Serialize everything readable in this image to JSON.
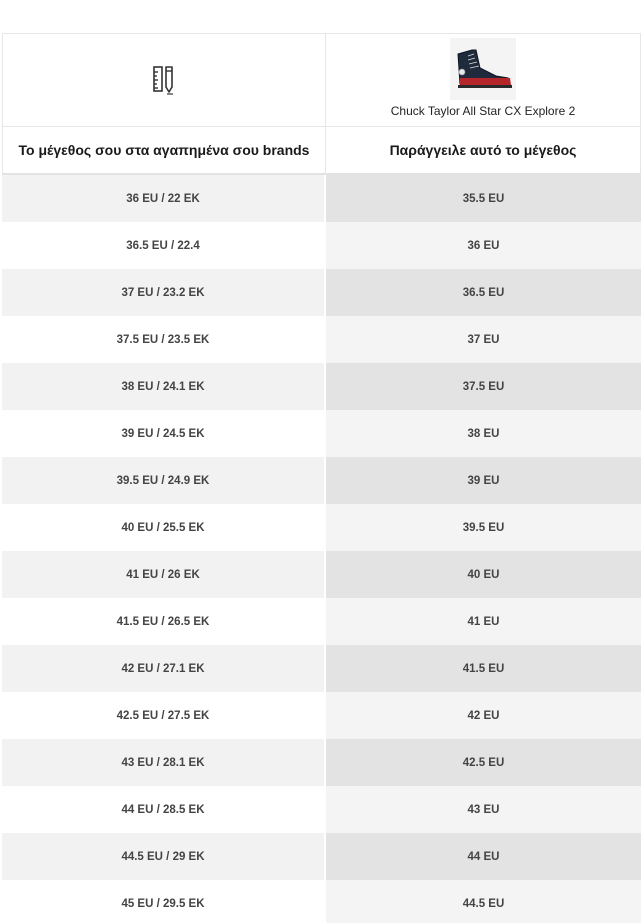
{
  "header": {
    "icon": "ruler-pencil-icon",
    "product_image": "sneaker-image",
    "product_name": "Chuck Taylor All Star CX Explore 2"
  },
  "columns": {
    "left": "Το μέγεθος σου στα αγαπημένα σου brands",
    "right": "Παράγγειλε αυτό το μέγεθος"
  },
  "rows": [
    {
      "brand_size": "36 EU / 22 ΕΚ",
      "order_size": "35.5 EU"
    },
    {
      "brand_size": "36.5 EU / 22.4",
      "order_size": "36 EU"
    },
    {
      "brand_size": "37 EU / 23.2 ΕΚ",
      "order_size": "36.5 EU"
    },
    {
      "brand_size": "37.5 EU / 23.5 ΕΚ",
      "order_size": "37 EU"
    },
    {
      "brand_size": "38 EU / 24.1 ΕΚ",
      "order_size": "37.5 EU"
    },
    {
      "brand_size": "39 EU / 24.5 ΕΚ",
      "order_size": "38 EU"
    },
    {
      "brand_size": "39.5 EU / 24.9 ΕΚ",
      "order_size": "39 EU"
    },
    {
      "brand_size": "40 EU / 25.5 ΕΚ",
      "order_size": "39.5 EU"
    },
    {
      "brand_size": "41 EU / 26 ΕΚ",
      "order_size": "40 EU"
    },
    {
      "brand_size": "41.5 EU / 26.5 ΕΚ",
      "order_size": "41 EU"
    },
    {
      "brand_size": "42 EU / 27.1 ΕΚ",
      "order_size": "41.5 EU"
    },
    {
      "brand_size": "42.5 EU / 27.5 ΕΚ",
      "order_size": "42 EU"
    },
    {
      "brand_size": "43 EU / 28.1 ΕΚ",
      "order_size": "42.5 EU"
    },
    {
      "brand_size": "44 EU / 28.5 ΕΚ",
      "order_size": "43 EU"
    },
    {
      "brand_size": "44.5 EU / 29 ΕΚ",
      "order_size": "44 EU"
    },
    {
      "brand_size": "45 EU / 29.5 ΕΚ",
      "order_size": "44.5 EU"
    }
  ]
}
